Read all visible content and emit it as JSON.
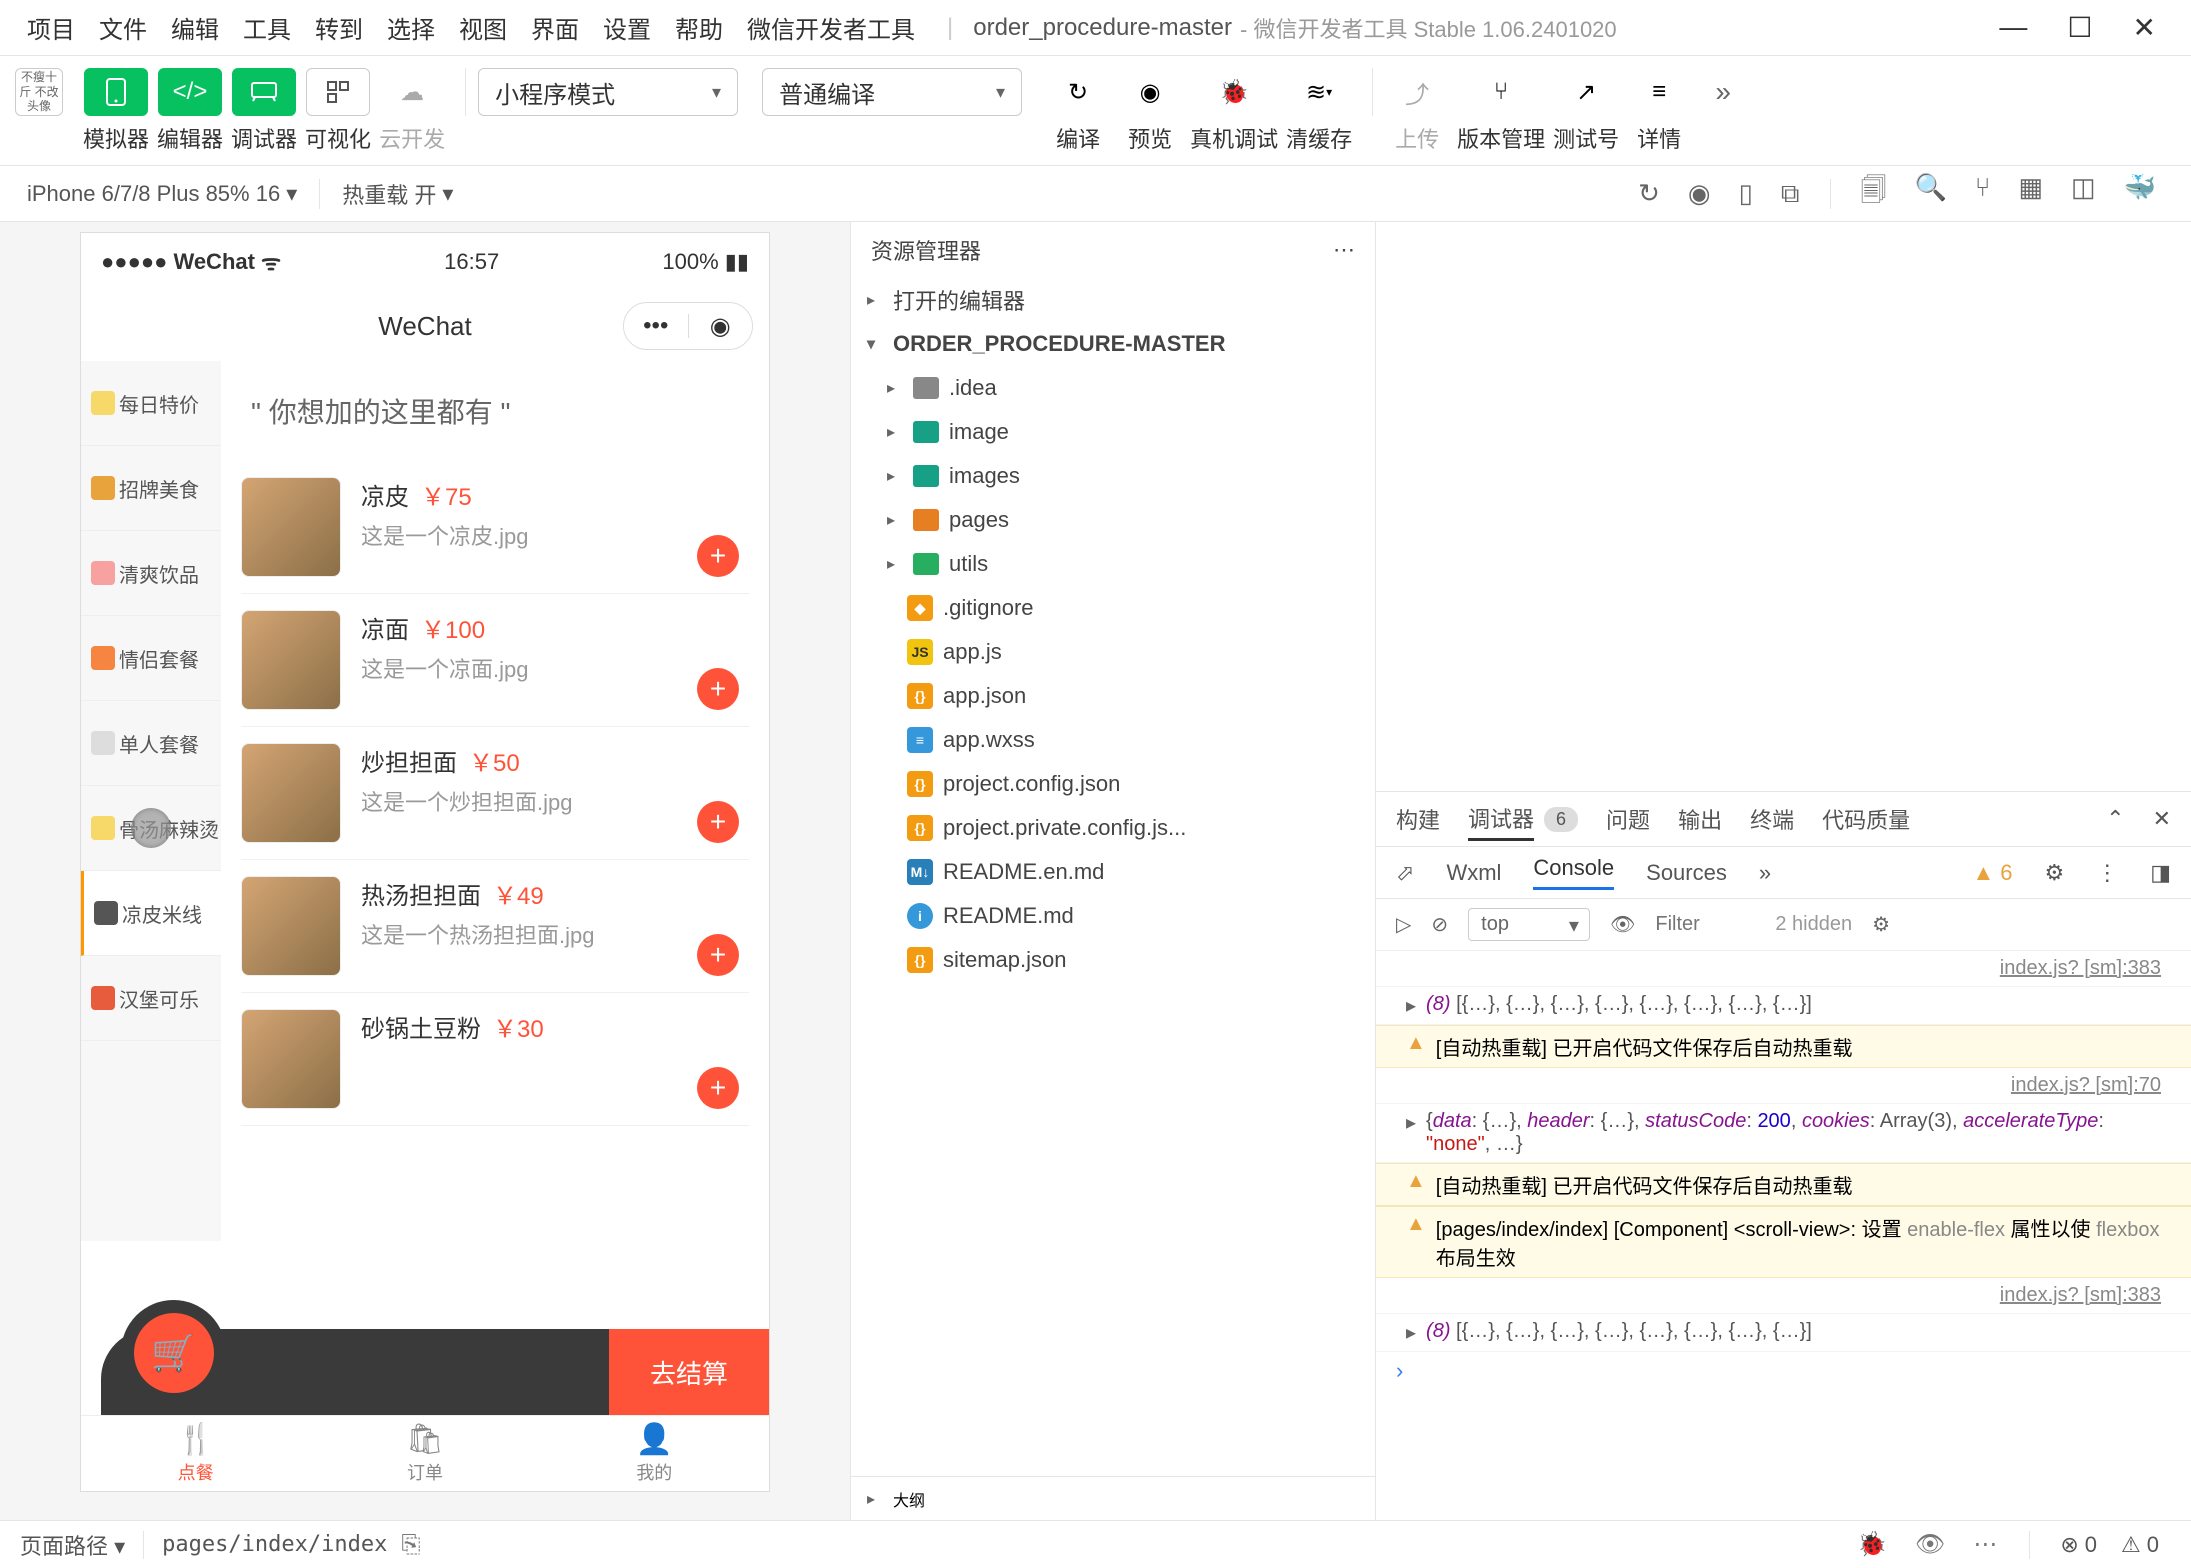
{
  "window": {
    "menus": [
      "项目",
      "文件",
      "编辑",
      "工具",
      "转到",
      "选择",
      "视图",
      "界面",
      "设置",
      "帮助",
      "微信开发者工具"
    ],
    "project_name": "order_procedure-master",
    "project_sub": "- 微信开发者工具 Stable 1.06.2401020"
  },
  "toolbar": {
    "avatar_text": "不瘦十斤\n不改头像",
    "simulator": "模拟器",
    "editor": "编辑器",
    "debugger": "调试器",
    "visual": "可视化",
    "cloud_dev": "云开发",
    "mode_select": "小程序模式",
    "compile_select": "普通编译",
    "compile": "编译",
    "preview": "预览",
    "real_debug": "真机调试",
    "clear_cache": "清缓存",
    "upload": "上传",
    "version_mgmt": "版本管理",
    "test_id": "测试号",
    "details": "详情"
  },
  "device_bar": {
    "device": "iPhone 6/7/8 Plus 85% 16",
    "hot_reload": "热重载 开"
  },
  "simulator": {
    "carrier": "WeChat",
    "time": "16:57",
    "battery": "100%",
    "nav_title": "WeChat",
    "section_title": "\" 你想加的这里都有 \"",
    "categories": [
      {
        "label": "每日特价",
        "color": "#f7d96a"
      },
      {
        "label": "招牌美食",
        "color": "#e8a33d"
      },
      {
        "label": "清爽饮品",
        "color": "#f7a1a1"
      },
      {
        "label": "情侣套餐",
        "color": "#f58540"
      },
      {
        "label": "单人套餐",
        "color": "#dddddd"
      },
      {
        "label": "骨汤麻辣烫",
        "color": "#f7d96a"
      },
      {
        "label": "凉皮米线",
        "color": "#555555"
      },
      {
        "label": "汉堡可乐",
        "color": "#e85c3e"
      }
    ],
    "active_cat_index": 6,
    "foods": [
      {
        "name": "凉皮",
        "price": "￥75",
        "desc": "这是一个凉皮.jpg"
      },
      {
        "name": "凉面",
        "price": "￥100",
        "desc": "这是一个凉面.jpg"
      },
      {
        "name": "炒担担面",
        "price": "￥50",
        "desc": "这是一个炒担担面.jpg"
      },
      {
        "name": "热汤担担面",
        "price": "￥49",
        "desc": "这是一个热汤担担面.jpg"
      },
      {
        "name": "砂锅土豆粉",
        "price": "￥30",
        "desc": ""
      }
    ],
    "checkout": "去结算",
    "tabs": [
      {
        "label": "点餐",
        "icon": "🍴"
      },
      {
        "label": "订单",
        "icon": "🛍"
      },
      {
        "label": "我的",
        "icon": "👤"
      }
    ]
  },
  "explorer": {
    "title": "资源管理器",
    "open_editors": "打开的编辑器",
    "project_root": "ORDER_PROCEDURE-MASTER",
    "folders": [
      {
        "name": ".idea",
        "color": "fi-gray"
      },
      {
        "name": "image",
        "color": "fi-teal"
      },
      {
        "name": "images",
        "color": "fi-teal"
      },
      {
        "name": "pages",
        "color": "fi-orange"
      },
      {
        "name": "utils",
        "color": "fi-green"
      }
    ],
    "files": [
      {
        "name": ".gitignore",
        "badge": "fb-json",
        "badge_txt": "◆"
      },
      {
        "name": "app.js",
        "badge": "fb-yellow",
        "badge_txt": "JS"
      },
      {
        "name": "app.json",
        "badge": "fb-json",
        "badge_txt": "{}"
      },
      {
        "name": "app.wxss",
        "badge": "fb-blue",
        "badge_txt": "≡"
      },
      {
        "name": "project.config.json",
        "badge": "fb-json",
        "badge_txt": "{}"
      },
      {
        "name": "project.private.config.js...",
        "badge": "fb-json",
        "badge_txt": "{}"
      },
      {
        "name": "README.en.md",
        "badge": "fb-md",
        "badge_txt": "M↓"
      },
      {
        "name": "README.md",
        "badge": "fb-info",
        "badge_txt": "i"
      },
      {
        "name": "sitemap.json",
        "badge": "fb-json",
        "badge_txt": "{}"
      }
    ],
    "outline": "大纲"
  },
  "debugger": {
    "top_tabs": [
      "构建",
      "调试器",
      "问题",
      "输出",
      "终端",
      "代码质量"
    ],
    "badge_count": "6",
    "sub_tabs": [
      "Wxml",
      "Console",
      "Sources"
    ],
    "warn_count": "6",
    "context": "top",
    "filter_placeholder": "Filter",
    "hidden_text": "2 hidden",
    "logs": [
      {
        "type": "source",
        "text": "index.js? [sm]:383"
      },
      {
        "type": "obj",
        "text": "(8) [{…}, {…}, {…}, {…}, {…}, {…}, {…}, {…}]"
      },
      {
        "type": "warn",
        "text": "[自动热重载] 已开启代码文件保存后自动热重载"
      },
      {
        "type": "source",
        "text": "index.js? [sm]:70"
      },
      {
        "type": "obj2",
        "text": "{data: {…}, header: {…}, statusCode: 200, cookies: Array(3), accelerateType: \"none\", …}"
      },
      {
        "type": "warn",
        "text": "[自动热重载] 已开启代码文件保存后自动热重载"
      },
      {
        "type": "warn2",
        "text": "[pages/index/index] [Component] <scroll-view>: 设置 enable-flex 属性以使 flexbox 布局生效"
      },
      {
        "type": "source",
        "text": "index.js? [sm]:383"
      },
      {
        "type": "obj",
        "text": "(8) [{…}, {…}, {…}, {…}, {…}, {…}, {…}, {…}]"
      }
    ]
  },
  "statusbar": {
    "page_path_label": "页面路径",
    "page_path": "pages/index/index",
    "err_count": "0",
    "warn_count": "0"
  }
}
